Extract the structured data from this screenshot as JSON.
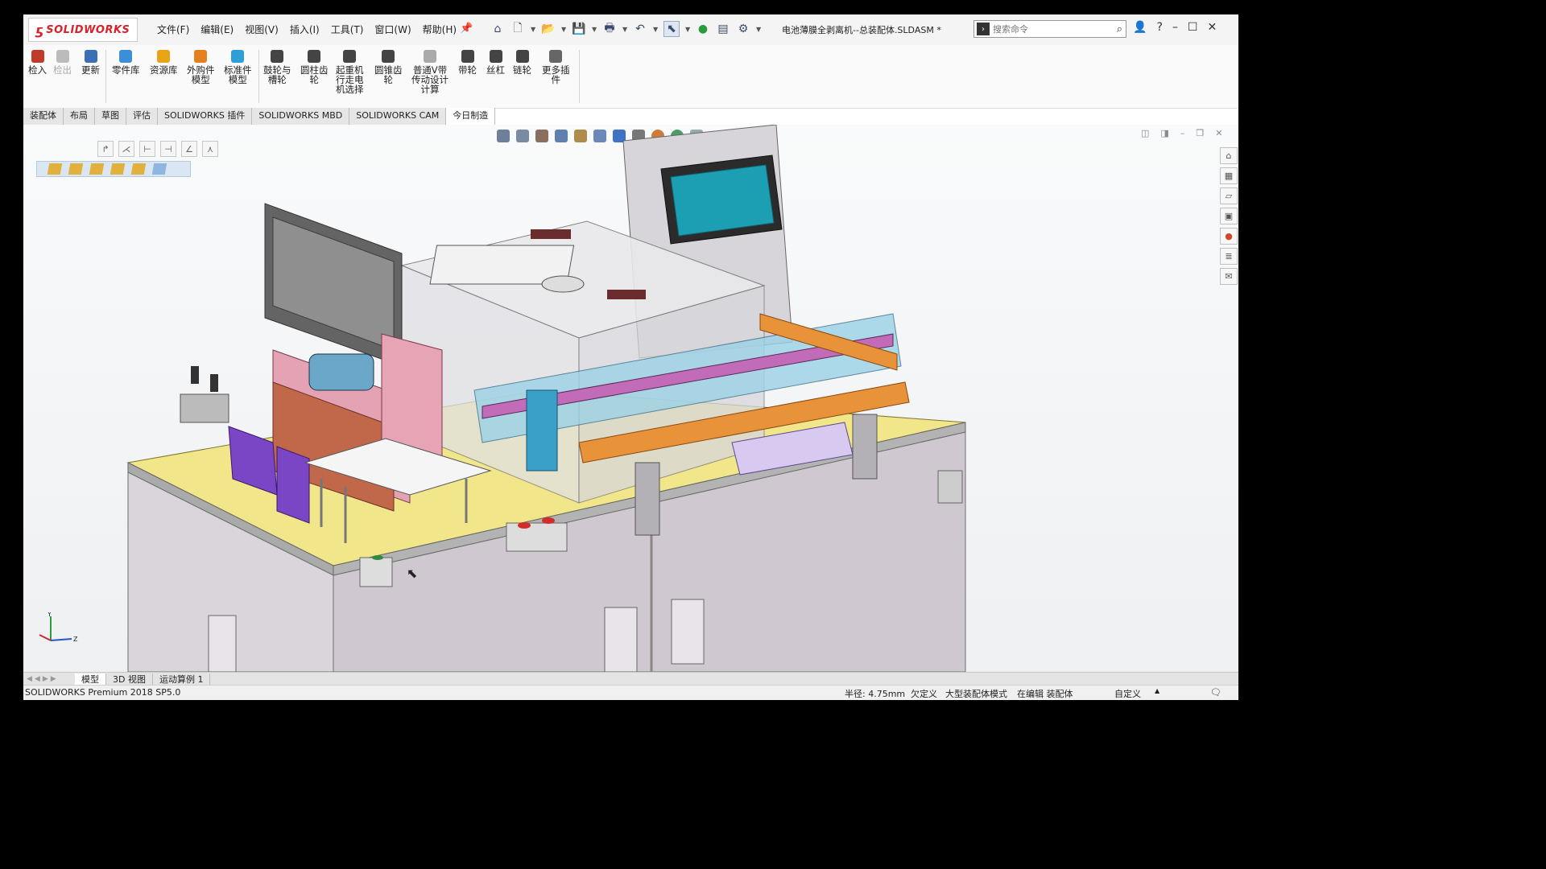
{
  "app": {
    "logo_text": "SOLIDWORKS",
    "document_title": "电池薄膜全剥离机--总装配体.SLDASM *"
  },
  "menu": [
    "文件(F)",
    "编辑(E)",
    "视图(V)",
    "插入(I)",
    "工具(T)",
    "窗口(W)",
    "帮助(H)"
  ],
  "search": {
    "placeholder": "搜索命令"
  },
  "toolbar": [
    {
      "label": "检入",
      "icon": "pdm-check-in-icon",
      "color": "#c0392b"
    },
    {
      "label": "检出",
      "icon": "pdm-check-out-icon",
      "color": "#bbbbbb",
      "disabled": true
    },
    {
      "label": "更新",
      "icon": "update-icon",
      "color": "#3b6fb6"
    },
    {
      "label": "零件库",
      "icon": "parts-library-icon",
      "color": "#3b8fd6"
    },
    {
      "label": "资源库",
      "icon": "resource-library-icon",
      "color": "#e8a317"
    },
    {
      "label": "外购件\n模型",
      "icon": "purchased-part-icon",
      "color": "#e67e22"
    },
    {
      "label": "标准件\n模型",
      "icon": "standard-part-icon",
      "color": "#2e9fd6"
    },
    {
      "label": "鼓轮与\n槽轮",
      "icon": "drum-wheel-icon",
      "color": "#444444"
    },
    {
      "label": "圆柱齿\n轮",
      "icon": "spur-gear-icon",
      "color": "#444444"
    },
    {
      "label": "起重机\n行走电\n机选择",
      "icon": "crane-motor-icon",
      "color": "#444444"
    },
    {
      "label": "圆锥齿\n轮",
      "icon": "bevel-gear-icon",
      "color": "#444444"
    },
    {
      "label": "普通V带\n传动设计\n计算",
      "icon": "v-belt-icon",
      "color": "#aaaaaa"
    },
    {
      "label": "带轮",
      "icon": "pulley-icon",
      "color": "#444444"
    },
    {
      "label": "丝杠",
      "icon": "lead-screw-icon",
      "color": "#444444"
    },
    {
      "label": "链轮",
      "icon": "sprocket-icon",
      "color": "#444444"
    },
    {
      "label": "更多插\n件",
      "icon": "more-plugins-icon",
      "color": "#666666"
    }
  ],
  "tabs": [
    "装配体",
    "布局",
    "草图",
    "评估",
    "SOLIDWORKS 插件",
    "SOLIDWORKS MBD",
    "SOLIDWORKS CAM",
    "今日制造"
  ],
  "active_tab": "今日制造",
  "bottom_tabs": [
    "模型",
    "3D 视图",
    "运动算例 1"
  ],
  "status": {
    "product": "SOLIDWORKS Premium 2018 SP5.0",
    "radius": "半径: 4.75mm",
    "definition": "欠定义",
    "mode": "大型装配体模式",
    "editing": "在编辑 装配体",
    "units": "自定义"
  },
  "axis_labels": {
    "y": "Y",
    "z": "Z"
  }
}
